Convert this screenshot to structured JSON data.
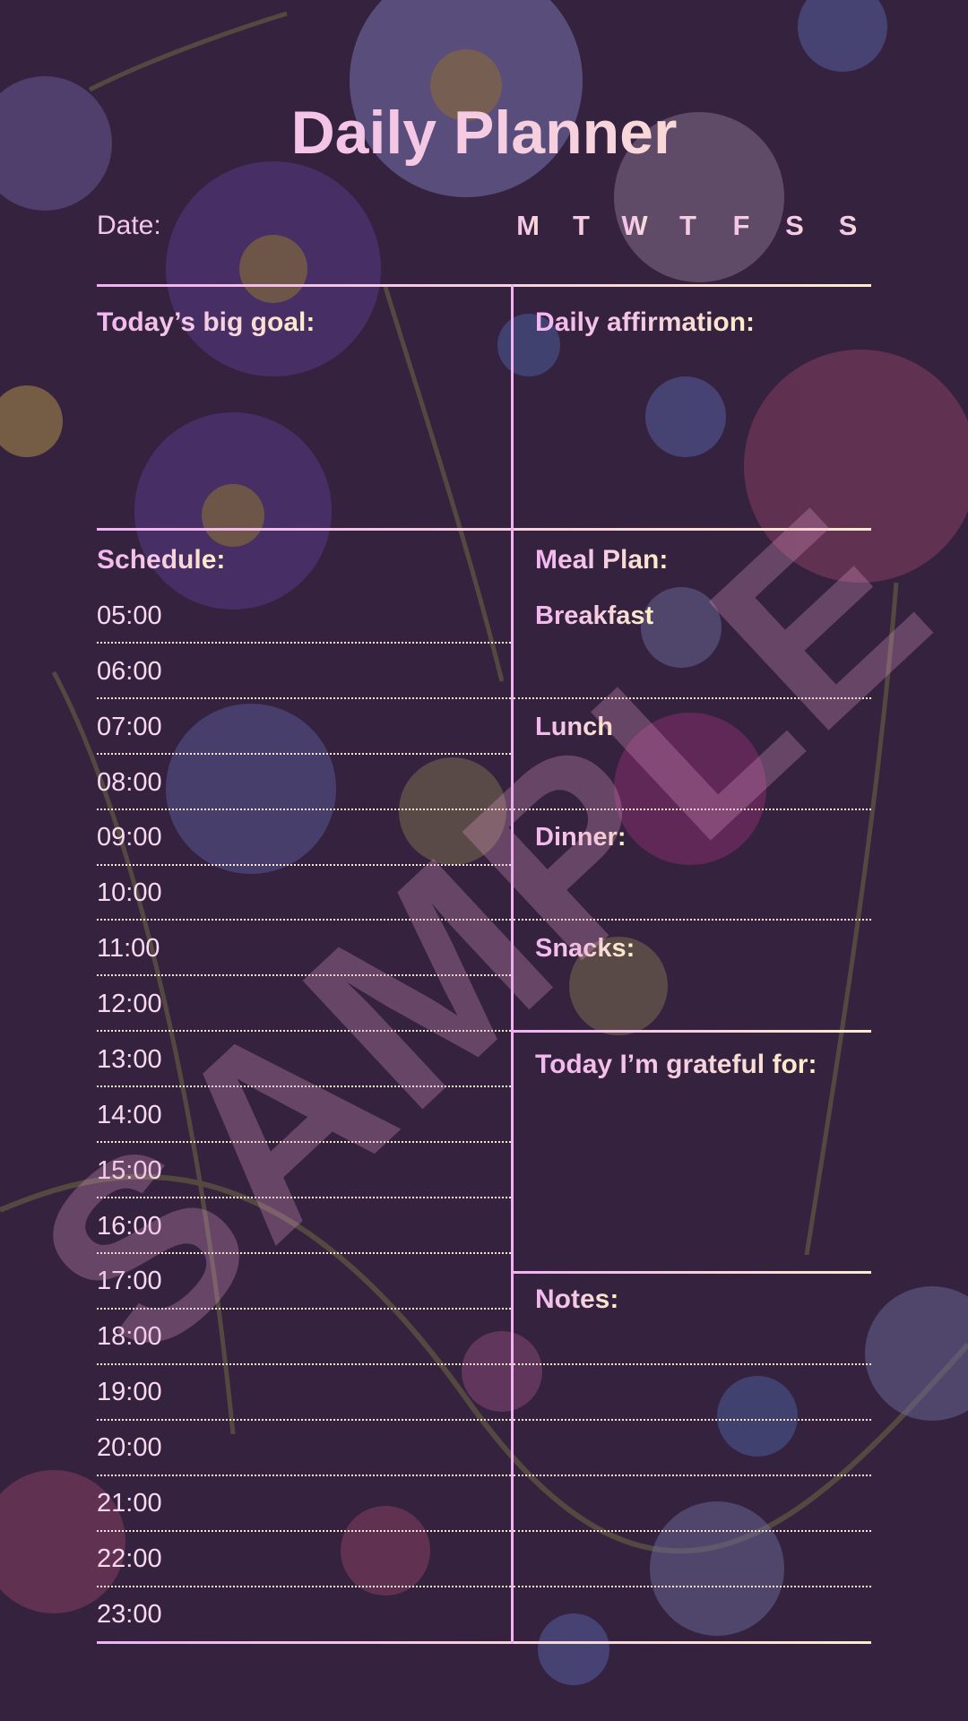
{
  "title": "Daily Planner",
  "date_label": "Date:",
  "weekdays": [
    "M",
    "T",
    "W",
    "T",
    "F",
    "S",
    "S"
  ],
  "sections": {
    "big_goal": "Today’s big goal:",
    "affirmation": "Daily affirmation:",
    "schedule": "Schedule:",
    "meal_plan": "Meal Plan:",
    "grateful": "Today I’m grateful for:",
    "notes": "Notes:"
  },
  "meals": [
    "Breakfast",
    "Lunch",
    "Dinner:",
    "Snacks:"
  ],
  "schedule_times": [
    "05:00",
    "06:00",
    "07:00",
    "08:00",
    "09:00",
    "10:00",
    "11:00",
    "12:00",
    "13:00",
    "14:00",
    "15:00",
    "16:00",
    "17:00",
    "18:00",
    "19:00",
    "20:00",
    "21:00",
    "22:00",
    "23:00"
  ],
  "watermark": "SAMPLE",
  "colors": {
    "background": "#35223f",
    "heading_gradient_start": "#f2b6f0",
    "heading_gradient_end": "#fff1c4",
    "line": "#f0b2f1"
  }
}
